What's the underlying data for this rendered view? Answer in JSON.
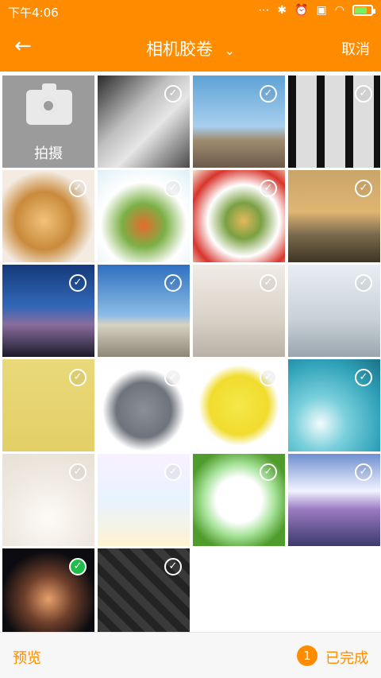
{
  "status": {
    "time": "下午4:06",
    "icons": [
      "more-icon",
      "bluetooth-icon",
      "alarm-off-icon",
      "sim-icon",
      "wifi-icon",
      "battery-icon"
    ]
  },
  "header": {
    "title": "相机胶卷",
    "cancel": "取消"
  },
  "camera": {
    "label": "拍摄"
  },
  "photos": [
    {
      "name": "corridor",
      "checked": false,
      "bg": "linear-gradient(135deg,#2a2a2a,#bfbfbf 40%,#e6e6e6 60%,#4a4a4a)"
    },
    {
      "name": "building-corner",
      "checked": false,
      "bg": "linear-gradient(180deg,#5ea2d6,#a8cfee 55%,#a08c70 70%,#6b5b4a)"
    },
    {
      "name": "railing-shadows",
      "checked": false,
      "bg": "repeating-linear-gradient(90deg,#111 0 10px,#ddd 10px 36px),linear-gradient(#fff,#777)"
    },
    {
      "name": "pasta-fork",
      "checked": false,
      "bg": "radial-gradient(circle at 45% 55%,#f0c37a,#c98a3b 40%,#f4ece3 70%)"
    },
    {
      "name": "pasta-salad",
      "checked": false,
      "bg": "radial-gradient(circle at 50% 60%,#e46b2d,#7bb046 30%,#ffffff 60%,#dff0f6)"
    },
    {
      "name": "spaghetti-plate",
      "checked": false,
      "bg": "radial-gradient(circle at 55% 55%,#e5b85c,#7aa043 25%,#ffffff 50%,#d8342b 75%,#f1e6d3)"
    },
    {
      "name": "bridge-boat",
      "checked": false,
      "bg": "linear-gradient(180deg,#c9a56a,#e0b572 45%,#7a6a4d 70%,#3e3524)"
    },
    {
      "name": "blue-mosque",
      "checked": false,
      "bg": "linear-gradient(180deg,#153a7a,#3267b8 45%,#8a6d9e 65%,#1a1a2a)"
    },
    {
      "name": "mosque-arches",
      "checked": false,
      "bg": "linear-gradient(180deg,#2f6fc0,#8bbde6 55%,#d8d2c2 65%,#8d8777)"
    },
    {
      "name": "white-living-room",
      "checked": false,
      "bg": "linear-gradient(180deg,#f0ece6,#d8d1c6 60%,#b9b1a5)"
    },
    {
      "name": "lounge-sofa",
      "checked": false,
      "bg": "linear-gradient(180deg,#e9eef2,#c8d1d8 60%,#9aa5ad)"
    },
    {
      "name": "yellow-note",
      "checked": false,
      "bg": "linear-gradient(180deg,#e9d97a,#e3cf66)"
    },
    {
      "name": "rhino-cartoon",
      "checked": false,
      "bg": "radial-gradient(circle at 50% 55%,#8a8f98,#6e737c 40%,#ffffff 60%)"
    },
    {
      "name": "yellow-cat",
      "checked": false,
      "bg": "radial-gradient(circle at 50% 50%,#f5e84a,#f1dc2e 45%,#ffffff 62%)"
    },
    {
      "name": "dandelion",
      "checked": false,
      "bg": "radial-gradient(circle at 35% 70%,#f3fbfc,#7ad0dc 30%,#2fa1b8 70%,#1a6f86)"
    },
    {
      "name": "bunny-cup",
      "checked": false,
      "bg": "radial-gradient(circle at 50% 70%,#fdfbf7,#efeae1 55%,#e6e0d6)"
    },
    {
      "name": "english-study",
      "checked": false,
      "bg": "linear-gradient(180deg,#f9f1ff,#e7f3ff 50%,#fff3d2)"
    },
    {
      "name": "green-frame",
      "checked": false,
      "bg": "radial-gradient(circle at 50% 50%,#ffffff 35%,#a7e39a 55%,#4f9b2b 80%)"
    },
    {
      "name": "sky-clouds",
      "checked": false,
      "bg": "linear-gradient(180deg,#6f8fd0,#f2f4ff 40%,#9b7bc2 60%,#3d3a6d)"
    },
    {
      "name": "hands-fire",
      "checked": true,
      "bg": "radial-gradient(circle at 50% 55%,#e7a06b,#6f3f2b 35%,#0c0c10 70%)"
    },
    {
      "name": "dark-cubes",
      "checked": false,
      "bg": "repeating-linear-gradient(45deg,#232323 0 10px,#3a3a3a 10px 20px)"
    }
  ],
  "bottom": {
    "preview": "预览",
    "count": "1",
    "done": "已完成"
  }
}
